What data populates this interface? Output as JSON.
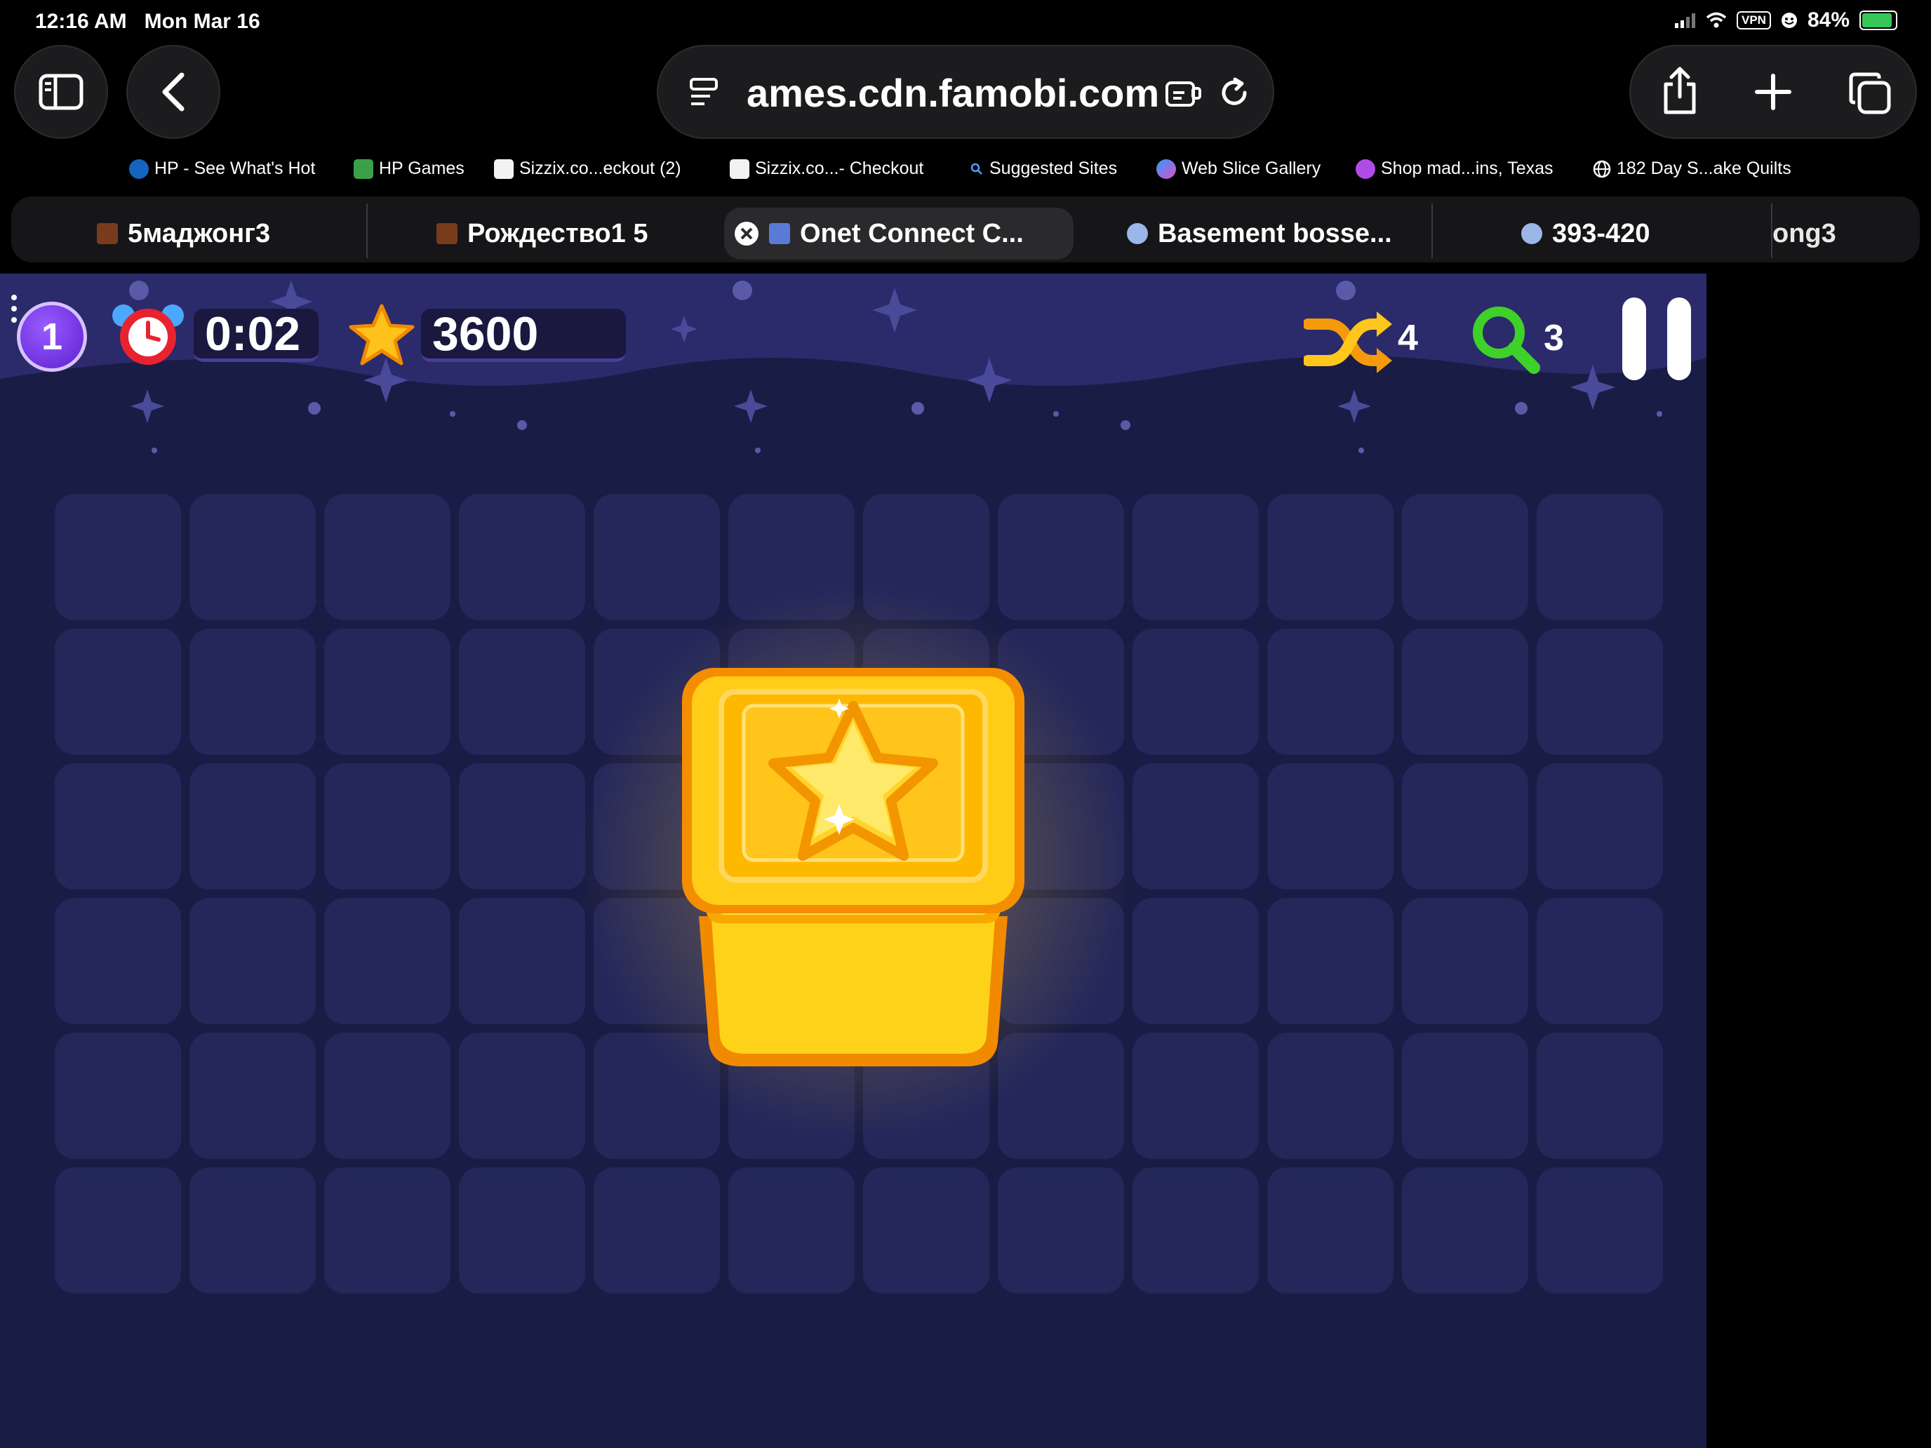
{
  "status_bar": {
    "time": "12:16 AM",
    "date": "Mon Mar 16",
    "vpn": "VPN",
    "battery": "84%"
  },
  "toolbar": {
    "url": "ames.cdn.famobi.com"
  },
  "bookmarks": [
    {
      "label": "HP - See What's Hot",
      "icon": "hp-icon"
    },
    {
      "label": "HP Games",
      "icon": "w-icon"
    },
    {
      "label": "Sizzix.co...eckout (2)",
      "icon": "sizzix-icon"
    },
    {
      "label": "Sizzix.co...- Checkout",
      "icon": "sizzix-icon"
    },
    {
      "label": "Suggested Sites",
      "icon": "search-icon"
    },
    {
      "label": "Web Slice Gallery",
      "icon": "butterfly-icon"
    },
    {
      "label": "Shop mad...ins, Texas",
      "icon": "peace-icon"
    },
    {
      "label": "182 Day S...ake Quilts",
      "icon": "globe-icon"
    }
  ],
  "tabs": [
    {
      "label": "5маджонг3"
    },
    {
      "label": "Рождество1 5"
    },
    {
      "label": "Onet Connect C..."
    },
    {
      "label": "Basement bosse..."
    },
    {
      "label": "393-420"
    },
    {
      "label": "ong3"
    }
  ],
  "game": {
    "level": "1",
    "timer": "0:02",
    "score": "3600",
    "shuffle_count": "4",
    "hint_count": "3",
    "grid_rows": 6,
    "grid_cols": 12,
    "tile_icon": "star-icon"
  }
}
